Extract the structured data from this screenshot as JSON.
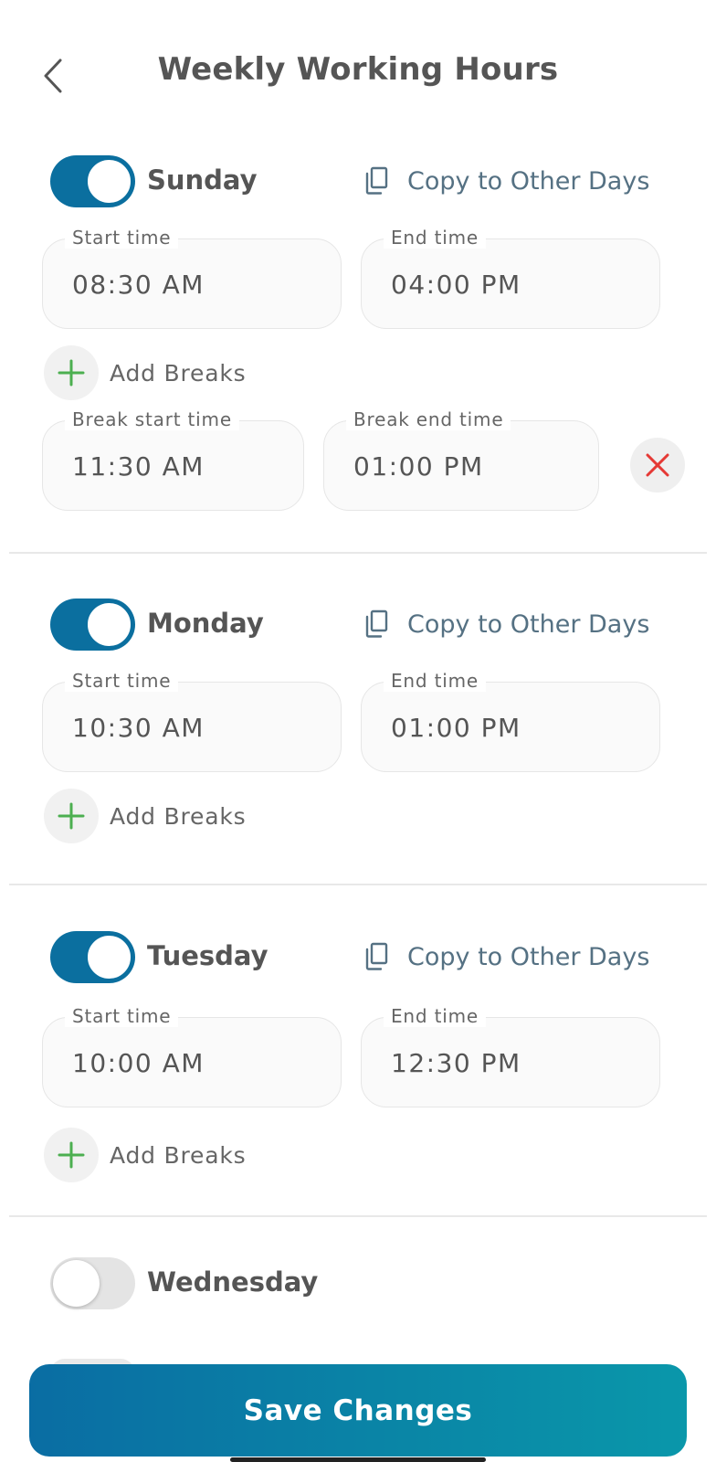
{
  "header": {
    "title": "Weekly Working Hours",
    "back_icon": "chevron-left-icon"
  },
  "labels": {
    "copy": "Copy to Other Days",
    "add_breaks": "Add Breaks",
    "start_time": "Start time",
    "end_time": "End time",
    "break_start_time": "Break start time",
    "break_end_time": "Break end time"
  },
  "days": [
    {
      "name": "Sunday",
      "enabled": true,
      "start": "08:30 AM",
      "end": "04:00 PM",
      "breaks": [
        {
          "start": "11:30 AM",
          "end": "01:00 PM"
        }
      ]
    },
    {
      "name": "Monday",
      "enabled": true,
      "start": "10:30 AM",
      "end": "01:00 PM",
      "breaks": []
    },
    {
      "name": "Tuesday",
      "enabled": true,
      "start": "10:00 AM",
      "end": "12:30 PM",
      "breaks": []
    },
    {
      "name": "Wednesday",
      "enabled": false
    }
  ],
  "footer": {
    "save_label": "Save Changes"
  },
  "colors": {
    "primary": "#0b6f9f",
    "add": "#4caf50",
    "remove": "#e53935",
    "copy_text": "#557183"
  }
}
